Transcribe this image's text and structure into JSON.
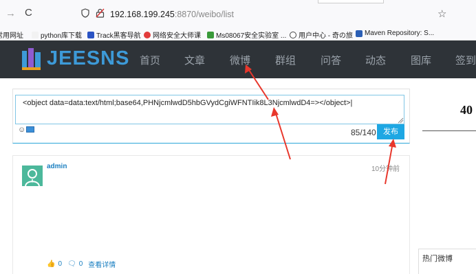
{
  "browser": {
    "url_host": "192.168.199.245",
    "url_rest": ":8870/weibo/list",
    "bookmarks": [
      "常用网址",
      "python库下载",
      "Track黑客导航",
      "网络安全大师课",
      "Ms08067安全实验室 ...",
      "用户中心 - 奇の旅",
      "Maven Repository: S..."
    ]
  },
  "site": {
    "logo_text": "JEESNS",
    "nav": [
      "首页",
      "文章",
      "微博",
      "群组",
      "问答",
      "动态",
      "图库",
      "签到"
    ]
  },
  "post_box": {
    "input_value": "<object data=data:text/html;base64,PHNjcmlwdD5hbGVydCgiWFNTIik8L3NjcmlwdD4=></object>|",
    "counter": "85/140",
    "publish_label": "发布"
  },
  "feed": {
    "author": "admin",
    "time": "10分钟前",
    "likes": "0",
    "comments": "0",
    "details_label": "查看详情"
  },
  "sidebar": {
    "big_number": "40",
    "hot_title": "热门微博"
  },
  "colors": {
    "navbar_bg": "#2e3338",
    "accent": "#1ea7e3",
    "annotation": "#e8372c"
  }
}
